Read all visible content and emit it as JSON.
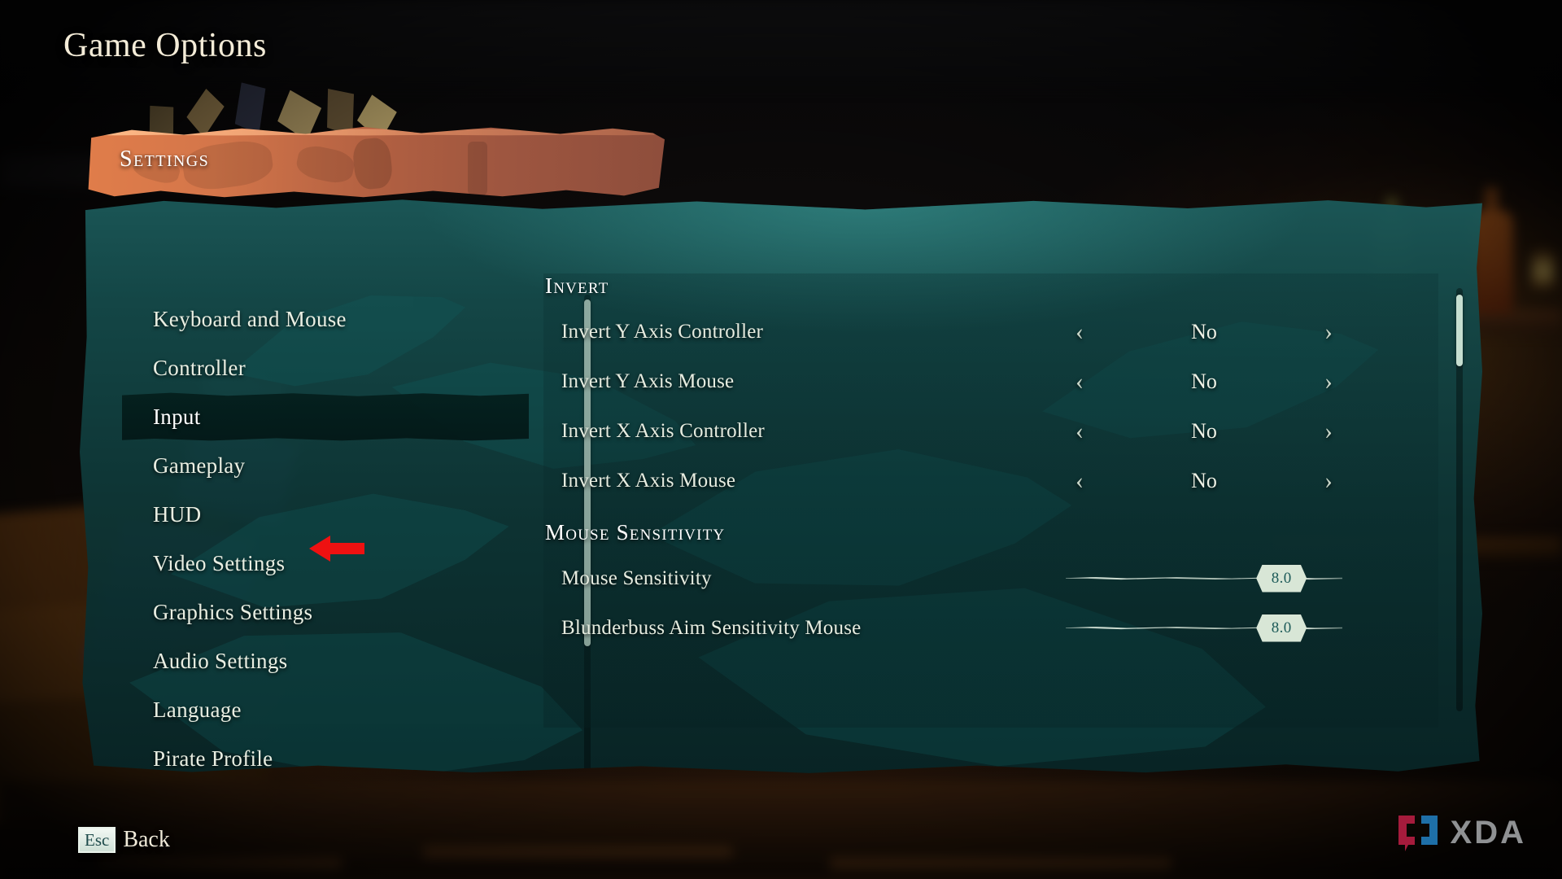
{
  "page_title": "Game Options",
  "banner": {
    "label": "Settings"
  },
  "sidebar": {
    "items": [
      {
        "label": "Keyboard and Mouse",
        "selected": false
      },
      {
        "label": "Controller",
        "selected": false
      },
      {
        "label": "Input",
        "selected": true
      },
      {
        "label": "Gameplay",
        "selected": false
      },
      {
        "label": "HUD",
        "selected": false
      },
      {
        "label": "Video Settings",
        "selected": false
      },
      {
        "label": "Graphics Settings",
        "selected": false
      },
      {
        "label": "Audio Settings",
        "selected": false
      },
      {
        "label": "Language",
        "selected": false
      },
      {
        "label": "Pirate Profile",
        "selected": false
      }
    ]
  },
  "content": {
    "sections": [
      {
        "heading": "Invert",
        "rows": [
          {
            "label": "Invert Y Axis Controller",
            "type": "selector",
            "value": "No",
            "left_arrow": "‹",
            "right_arrow": "›"
          },
          {
            "label": "Invert Y Axis Mouse",
            "type": "selector",
            "value": "No",
            "left_arrow": "‹",
            "right_arrow": "›"
          },
          {
            "label": "Invert X Axis Controller",
            "type": "selector",
            "value": "No",
            "left_arrow": "‹",
            "right_arrow": "›"
          },
          {
            "label": "Invert X Axis Mouse",
            "type": "selector",
            "value": "No",
            "left_arrow": "‹",
            "right_arrow": "›"
          }
        ]
      },
      {
        "heading": "Mouse Sensitivity",
        "rows": [
          {
            "label": "Mouse Sensitivity",
            "type": "slider",
            "value": "8.0",
            "percent": 78
          },
          {
            "label": "Blunderbuss Aim Sensitivity Mouse",
            "type": "slider",
            "value": "8.0",
            "percent": 78
          }
        ]
      }
    ]
  },
  "footer": {
    "back_key": "Esc",
    "back_label": "Back"
  },
  "watermark": {
    "text": "XDA"
  },
  "colors": {
    "banner_orange": "#d4764a",
    "panel_teal": "#145050",
    "selected_row": "#041e1c",
    "text_cream": "#e9eee2",
    "slider_handle": "#d8e6d6",
    "annotation_red": "#ee1111",
    "xda_red": "#a51b3c",
    "xda_blue": "#1e6fa8",
    "xda_gray": "#8f9193"
  }
}
